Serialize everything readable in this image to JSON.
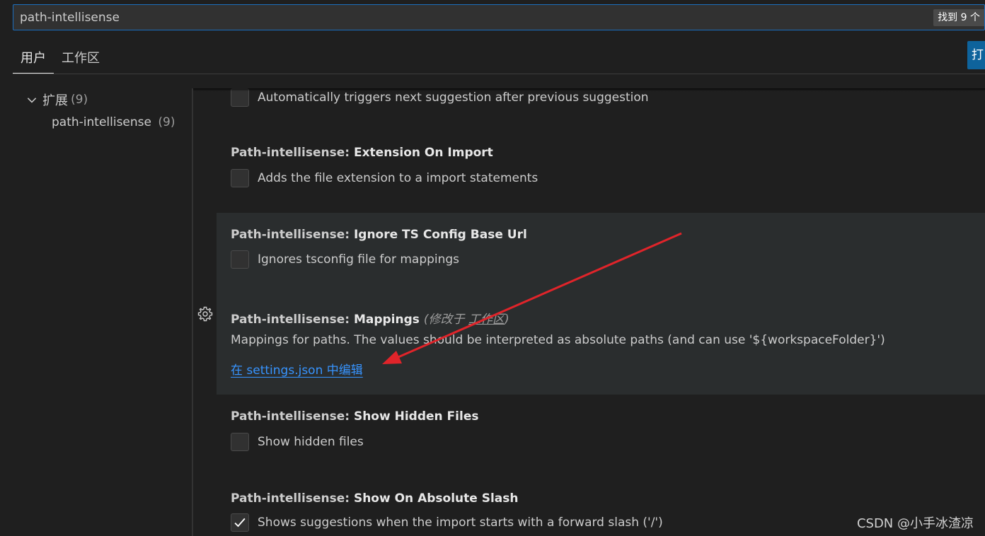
{
  "search": {
    "value": "path-intellisense",
    "result_count": "找到 9 个"
  },
  "tabs": [
    {
      "label": "用户",
      "active": true
    },
    {
      "label": "工作区",
      "active": false
    }
  ],
  "open_json_button": {
    "label": "打"
  },
  "toc": {
    "group_label": "扩展",
    "group_count": "(9)",
    "item_label": "path-intellisense",
    "item_count": "(9)"
  },
  "settings": {
    "auto_trigger": {
      "label": "Automatically triggers next suggestion after previous suggestion",
      "checked": false
    },
    "extension_on_import": {
      "category": "Path-intellisense: ",
      "key": "Extension On Import",
      "label": "Adds the file extension to a import statements",
      "checked": false
    },
    "ignore_ts": {
      "category": "Path-intellisense: ",
      "key": "Ignore TS Config Base Url",
      "label": "Ignores tsconfig file for mappings",
      "checked": false
    },
    "mappings": {
      "category": "Path-intellisense: ",
      "key": "Mappings",
      "modified_prefix": "(修改于 ",
      "modified_scope": "工作区",
      "modified_suffix": ")",
      "description": "Mappings for paths. The values should be interpreted as absolute paths (and can use '${workspaceFolder}')",
      "edit_link": "在 settings.json 中编辑"
    },
    "show_hidden": {
      "category": "Path-intellisense: ",
      "key": "Show Hidden Files",
      "label": "Show hidden files",
      "checked": false
    },
    "absolute_slash": {
      "category": "Path-intellisense: ",
      "key": "Show On Absolute Slash",
      "label": "Shows suggestions when the import starts with a forward slash ('/')",
      "checked": true
    }
  },
  "watermark": "CSDN @小手冰渣凉",
  "colors": {
    "accent": "#3794ff",
    "annotation_arrow": "#e0242a",
    "focus_border": "#1b6fbf"
  },
  "icons": [
    "chevron-down-icon",
    "gear-icon",
    "check-icon"
  ]
}
